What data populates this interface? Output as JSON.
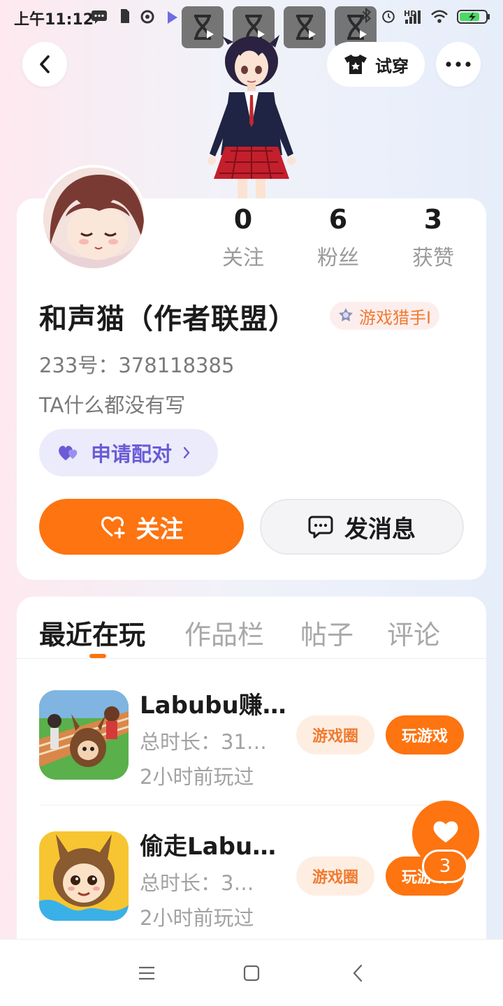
{
  "status_bar": {
    "time": "上午11:12",
    "network_label": "HD"
  },
  "header": {
    "back_icon": "chevron-left-icon",
    "tryon_label": "试穿",
    "tryon_icon": "tshirt-icon",
    "more_icon": "more-dots-icon"
  },
  "profile": {
    "stats": [
      {
        "value": "0",
        "label": "关注"
      },
      {
        "value": "6",
        "label": "粉丝"
      },
      {
        "value": "3",
        "label": "获赞"
      }
    ],
    "username": "和声猫（作者联盟）",
    "badge_label": "游戏猎手I",
    "user_id": "233号：378118385",
    "bio": "TA什么都没有写",
    "pair_button_label": "申请配对",
    "follow_button_label": "关注",
    "message_button_label": "发消息"
  },
  "tabs": [
    {
      "label": "最近在玩",
      "active": true
    },
    {
      "label": "作品栏",
      "active": false
    },
    {
      "label": "帖子",
      "active": false
    },
    {
      "label": "评论",
      "active": false
    }
  ],
  "games": [
    {
      "title": "Labubu赚…",
      "playtime": "总时长：31…",
      "last_played": "2小时前玩过",
      "circle_label": "游戏圈",
      "play_label": "玩游戏"
    },
    {
      "title": "偷走Labu…",
      "playtime": "总时长：3…",
      "last_played": "2小时前玩过",
      "circle_label": "游戏圈",
      "play_label": "玩游戏"
    }
  ],
  "like_fab": {
    "count": "3",
    "icon": "heart-icon"
  },
  "colors": {
    "accent": "#fd7411",
    "pair_purple": "#6b5bd6",
    "muted_text": "#9a9a9a"
  }
}
